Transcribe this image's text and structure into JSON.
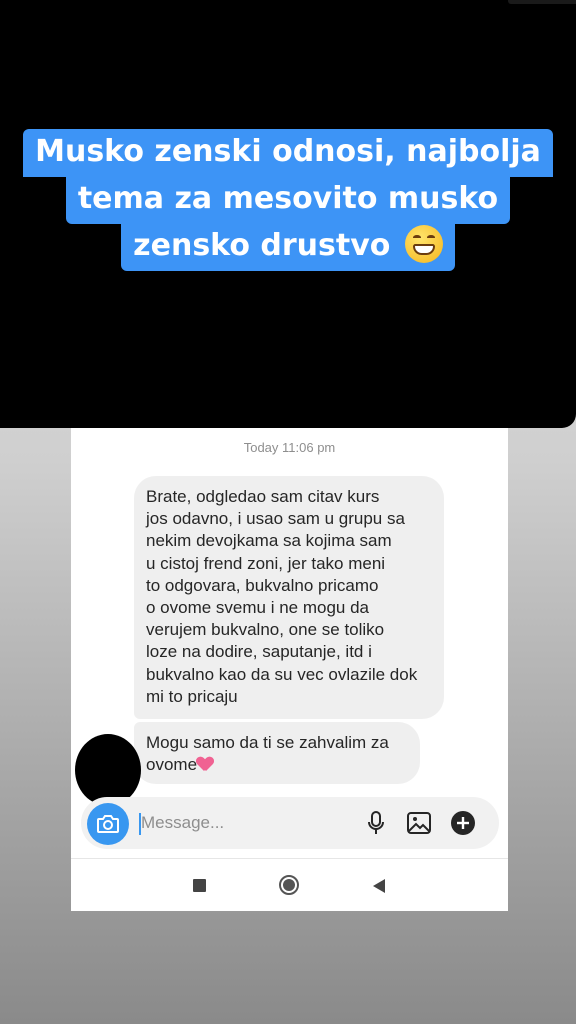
{
  "story_caption": {
    "line1": "Musko zenski odnosi, najbolja",
    "line2": "tema za mesovito musko",
    "line3": "zensko drustvo",
    "emoji": "grinning-face-emoji"
  },
  "chat": {
    "timestamp": "Today 11:06 pm",
    "messages": [
      {
        "text": "Brate, odgledao sam citav kurs\njos odavno, i usao sam u grupu sa\nnekim devojkama sa kojima sam\nu cistoj frend zoni, jer tako meni\nto odgovara, bukvalno pricamo\no ovome svemu i ne mogu da\nverujem bukvalno, one se toliko\nloze na dodire, saputanje, itd i\nbukvalno kao da su vec ovlazile dok\nmi to pricaju"
      },
      {
        "text": "Mogu samo da ti se zahvalim za\novome",
        "emoji": "sparkling-heart-emoji"
      }
    ]
  },
  "composer": {
    "placeholder": "Message...",
    "icons": [
      "camera-icon",
      "microphone-icon",
      "gallery-icon",
      "plus-icon"
    ]
  },
  "navbar": {
    "icons": [
      "recents-icon",
      "home-icon",
      "back-icon"
    ]
  },
  "colors": {
    "caption_bg": "#3d94f6",
    "accent": "#3897f0",
    "bubble_bg": "#efefef"
  }
}
